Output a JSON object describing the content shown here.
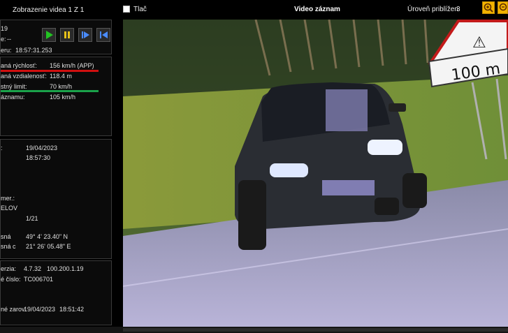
{
  "header": {
    "left_title": "Zobrazenie videa 1 Z 1",
    "print_label": "Tlač",
    "video_title": "Video záznam",
    "zoom_label": "Úroveň priblížen",
    "zoom_value": "3"
  },
  "panel_top": {
    "line1": "19",
    "line2_label": "e:",
    "line2_value": "--",
    "line3_label": "eru:",
    "line3_value": "18:57:31.253"
  },
  "panel_measure": {
    "speed_label": "aná rýchlosť:",
    "speed_value": "156 km/h (APP)",
    "distance_label": "aná vzdialenosť:",
    "distance_value": "118.4 m",
    "limit_label": "stný limit:",
    "limit_value": "70 km/h",
    "record_label": "áznamu:",
    "record_value": "105 km/h"
  },
  "panel_info": {
    "date_label": ":",
    "date_value": "19/04/2023",
    "time_value": "18:57:30",
    "direction_label": "mer.:",
    "place_text": "ELOV",
    "fraction": "1/21",
    "lat_label": "sná",
    "lat_value": "49° 4' 23.40\" N",
    "lon_label": "sná c",
    "lon_value": "21° 26' 05.48\" E"
  },
  "panel_device": {
    "version_label": "erzia:",
    "version_value": "4.7.32",
    "version_ip": "100.200.1.19",
    "serial_label": "é číslo:",
    "serial_value": "TC006701",
    "poweron_label": "né zarov",
    "poweron_date": "19/04/2023",
    "poweron_time": "18:51:42"
  },
  "controls": {
    "play_icon": "play-icon",
    "pause_icon": "pause-icon",
    "step_forward_icon": "step-forward-icon",
    "step_back_icon": "step-back-icon"
  },
  "video": {
    "sign_text": "100 m"
  },
  "colors": {
    "speed_underline": "#d01010",
    "limit_underline": "#1aa24a",
    "zoom_button": "#f2b300"
  }
}
